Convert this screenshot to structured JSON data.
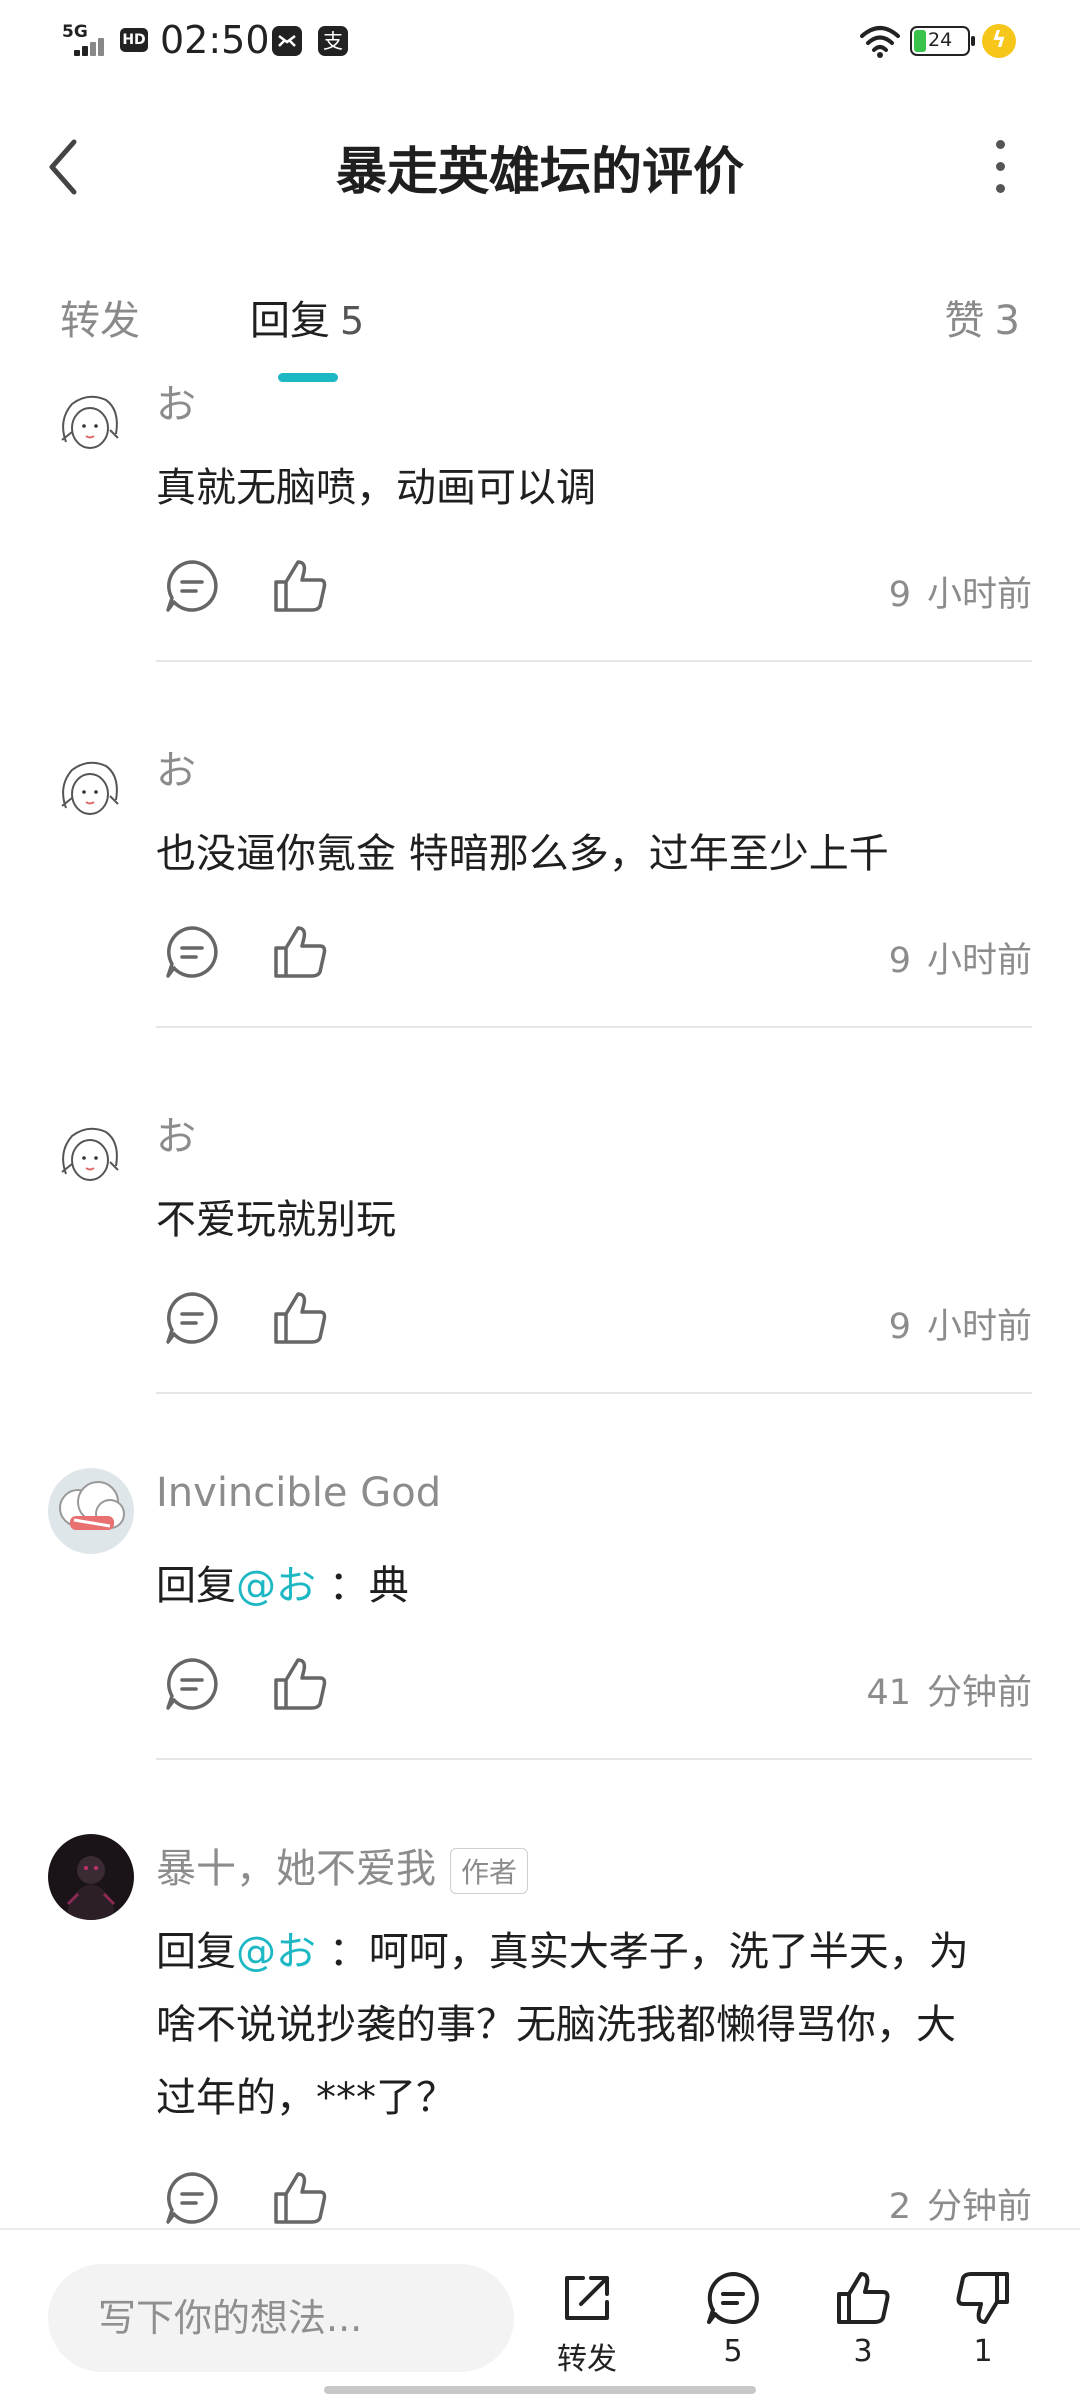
{
  "status_bar": {
    "network": "5G",
    "hd": "HD",
    "time": "02:50",
    "app_icon_2": "支",
    "battery": "24"
  },
  "header": {
    "title": "暴走英雄坛的评价"
  },
  "tabs": {
    "forward": {
      "label": "转发"
    },
    "reply": {
      "label": "回复",
      "count": "5"
    },
    "like": {
      "label": "赞",
      "count": "3"
    }
  },
  "comments": [
    {
      "user": "お",
      "text": "真就无脑喷，动画可以调",
      "time_num": "9",
      "time_unit": "小时前"
    },
    {
      "user": "お",
      "text": "也没逼你氪金  特暗那么多，过年至少上千",
      "time_num": "9",
      "time_unit": "小时前"
    },
    {
      "user": "お",
      "text": "不爱玩就别玩",
      "time_num": "9",
      "time_unit": "小时前"
    },
    {
      "user": "Invincible  God",
      "reply_prefix": "回复",
      "mention": "@お",
      "text": " ：典",
      "time_num": "41",
      "time_unit": "分钟前"
    },
    {
      "user": "暴十，她不爱我",
      "badge": "作者",
      "reply_prefix": "回复",
      "mention": "@お",
      "text_line1": " ：呵呵，真实大孝子，洗了半天，为",
      "text_line2": "啥不说说抄袭的事？无脑洗我都懒得骂你，大",
      "text_line3": "过年的，***了？",
      "time_num": "2",
      "time_unit": "分钟前"
    }
  ],
  "bottom_bar": {
    "input_placeholder": "写下你的想法...",
    "forward_label": "转发",
    "comment_count": "5",
    "like_count": "3",
    "dislike_count": "1"
  },
  "colors": {
    "accent": "#1eb8c5",
    "text": "#1f1f1f",
    "muted": "#8c8c8c"
  }
}
